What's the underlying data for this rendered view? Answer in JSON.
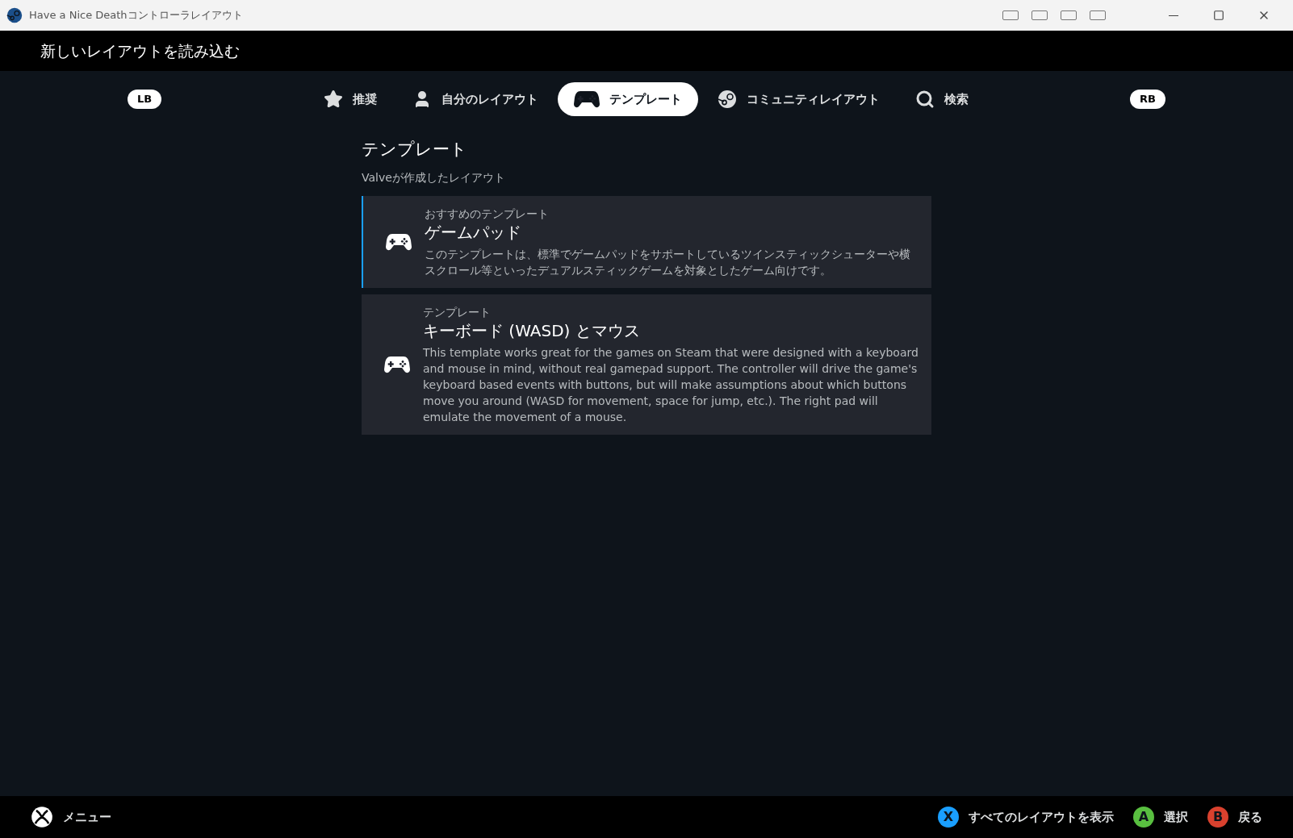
{
  "window": {
    "title": "Have a Nice Deathコントローラレイアウト"
  },
  "header": {
    "title": "新しいレイアウトを読み込む"
  },
  "tab_bar": {
    "left_bumper": "LB",
    "right_bumper": "RB",
    "tabs": [
      {
        "kind": "star",
        "label": "推奨",
        "selected": false
      },
      {
        "kind": "person",
        "label": "自分のレイアウト",
        "selected": false
      },
      {
        "kind": "gamepad",
        "label": "テンプレート",
        "selected": true
      },
      {
        "kind": "steam",
        "label": "コミュニティレイアウト",
        "selected": false
      },
      {
        "kind": "search",
        "label": "検索",
        "selected": false
      }
    ]
  },
  "section": {
    "title": "テンプレート",
    "subtitle": "Valveが作成したレイアウト"
  },
  "templates": [
    {
      "category": "おすすめのテンプレート",
      "name": "ゲームパッド",
      "description": "このテンプレートは、標準でゲームパッドをサポートしているツインスティックシューターや横スクロール等といったデュアルスティックゲームを対象としたゲーム向けです。",
      "selected": true
    },
    {
      "category": "テンプレート",
      "name": "キーボード (WASD) とマウス",
      "description": "This template works great for the games on Steam that were designed with a keyboard and mouse in mind, without real gamepad support. The controller will drive the game's keyboard based events with buttons, but will make assumptions about which buttons move you around (WASD for movement, space for jump, etc.). The right pad will emulate the movement of a mouse.",
      "selected": false
    }
  ],
  "footer": {
    "menu_label": "メニュー",
    "hints": [
      {
        "key": "X",
        "label": "すべてのレイアウトを表示",
        "color": "#1a9fff"
      },
      {
        "key": "A",
        "label": "選択",
        "color": "#59bf40"
      },
      {
        "key": "B",
        "label": "戻る",
        "color": "#d9412e"
      }
    ]
  }
}
